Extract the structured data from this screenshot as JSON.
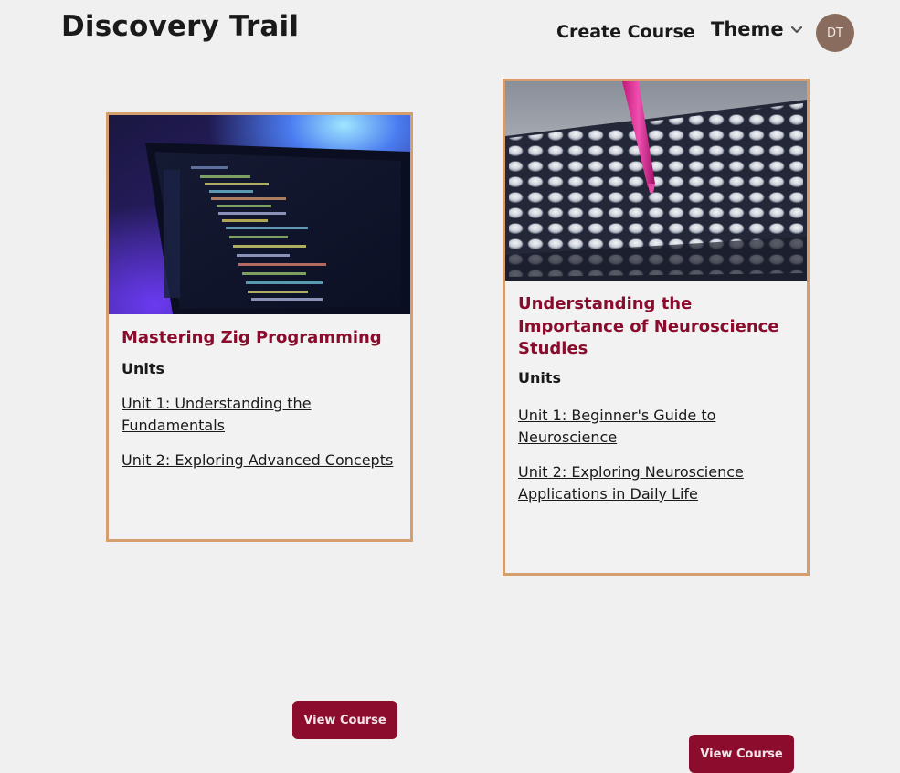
{
  "header": {
    "brand": "Discovery Trail",
    "create_course": "Create Course",
    "theme": "Theme",
    "avatar_initials": "DT"
  },
  "courses": [
    {
      "title": "Mastering Zig Programming",
      "units_label": "Units",
      "units": [
        "Unit 1: Understanding the Fundamentals",
        "Unit 2: Exploring Advanced Concepts"
      ],
      "button": "View Course",
      "image": "laptop-code-image"
    },
    {
      "title": "Understanding the Importance of Neuroscience Studies",
      "units_label": "Units",
      "units": [
        "Unit 1: Beginner's Guide to Neuroscience",
        "Unit 2: Exploring Neuroscience Applications in Daily Life"
      ],
      "button": "View Course",
      "image": "lab-pipette-image"
    }
  ],
  "colors": {
    "accent": "#8b0c2d",
    "card_border": "#d59e6e",
    "avatar": "#8a6c5e",
    "background": "#f0f0f0"
  }
}
